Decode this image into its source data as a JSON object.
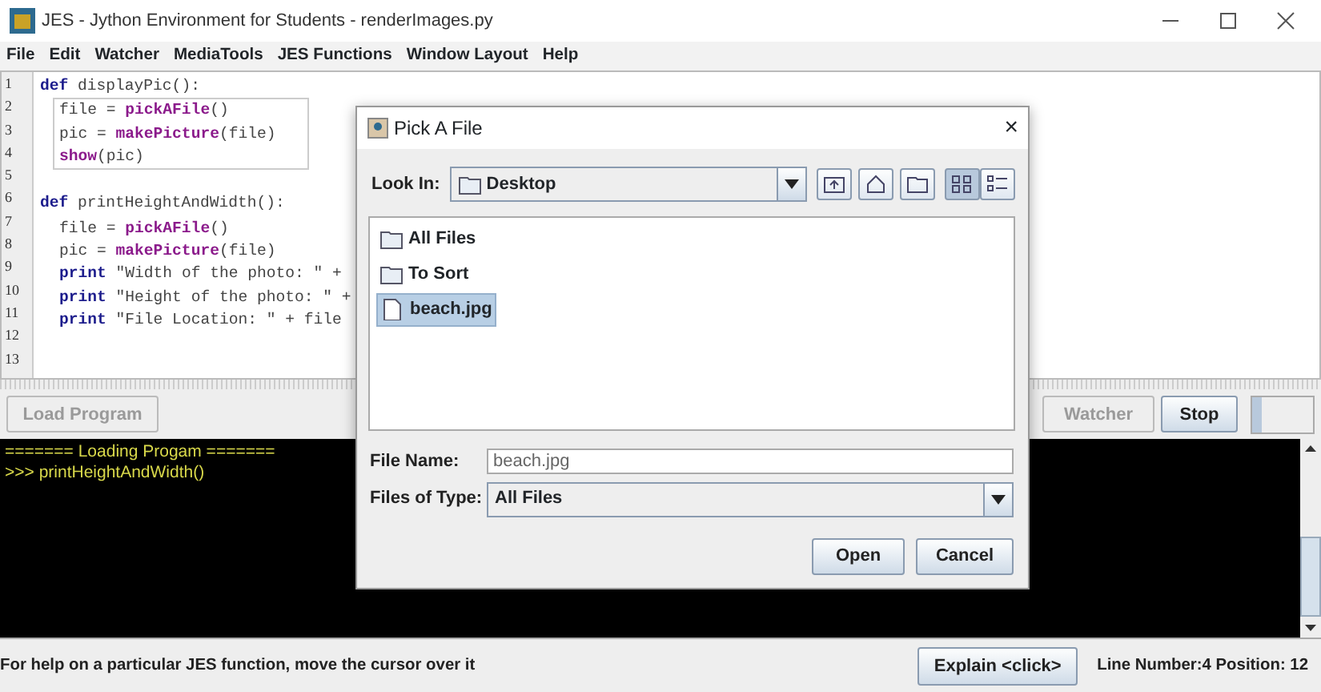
{
  "window": {
    "title": "JES - Jython Environment for Students - renderImages.py"
  },
  "menu": [
    "File",
    "Edit",
    "Watcher",
    "MediaTools",
    "JES Functions",
    "Window Layout",
    "Help"
  ],
  "editor": {
    "lines": [
      {
        "number": "1",
        "tokens": [
          {
            "kind": "keyword",
            "text": "def"
          },
          {
            "kind": "plain",
            "text": " displayPic():"
          }
        ],
        "body_boxed": true,
        "children": [
          {
            "number": "2",
            "tokens": [
              {
                "kind": "plain",
                "text": "file = "
              },
              {
                "kind": "builtin",
                "text": "pickAFile"
              },
              {
                "kind": "plain",
                "text": "()"
              }
            ]
          },
          {
            "number": "3",
            "tokens": [
              {
                "kind": "plain",
                "text": "pic = "
              },
              {
                "kind": "builtin",
                "text": "makePicture"
              },
              {
                "kind": "plain",
                "text": "(file)"
              }
            ]
          },
          {
            "number": "4",
            "tokens": [
              {
                "kind": "builtin",
                "text": "show"
              },
              {
                "kind": "plain",
                "text": "(pic)"
              }
            ]
          }
        ]
      },
      {
        "number": "5"
      },
      {
        "number": "6",
        "tokens": [
          {
            "kind": "keyword",
            "text": "def"
          },
          {
            "kind": "plain",
            "text": " printHeightAndWidth():"
          }
        ],
        "body_boxed": false,
        "children": [
          {
            "number": "7",
            "tokens": [
              {
                "kind": "plain",
                "text": "file = "
              },
              {
                "kind": "builtin",
                "text": "pickAFile"
              },
              {
                "kind": "plain",
                "text": "()"
              }
            ]
          },
          {
            "number": "8",
            "tokens": [
              {
                "kind": "plain",
                "text": "pic = "
              },
              {
                "kind": "builtin",
                "text": "makePicture"
              },
              {
                "kind": "plain",
                "text": "(file)"
              }
            ]
          },
          {
            "number": "9",
            "tokens": [
              {
                "kind": "keyword",
                "text": "print"
              },
              {
                "kind": "plain",
                "text": " \"Width of the photo: \" +"
              }
            ]
          },
          {
            "number": "10",
            "tokens": [
              {
                "kind": "keyword",
                "text": "print"
              },
              {
                "kind": "plain",
                "text": " \"Height of the photo: \" +"
              }
            ]
          },
          {
            "number": "11",
            "tokens": [
              {
                "kind": "keyword",
                "text": "print"
              },
              {
                "kind": "plain",
                "text": " \"File Location: \" + file"
              }
            ]
          }
        ]
      },
      {
        "number": "12"
      },
      {
        "number": "13"
      }
    ]
  },
  "toolbar": {
    "left": [
      {
        "label": "Load Program",
        "disabled": true
      }
    ],
    "right": [
      {
        "label": "Watcher",
        "disabled": true
      },
      {
        "label": "Stop",
        "disabled": false
      }
    ],
    "slider": {
      "level": 0.15
    }
  },
  "console": {
    "lines": [
      "======= Loading Progam =======",
      ">>> printHeightAndWidth()"
    ]
  },
  "status_bar": {
    "help": "For help on a particular JES function, move the cursor over it",
    "explain_button": "Explain <click>",
    "position": "Line Number:4 Position: 12"
  },
  "dialog": {
    "title": "Pick A File",
    "close": "×",
    "look_in": {
      "label": "Look In:",
      "value": "Desktop"
    },
    "nav_buttons": [
      {
        "kind": "up",
        "selected": false
      },
      {
        "kind": "home",
        "selected": false
      },
      {
        "kind": "newfolder",
        "selected": false
      },
      {
        "kind": "list",
        "selected": true
      },
      {
        "kind": "details",
        "selected": false
      }
    ],
    "files": [
      {
        "kind": "folder",
        "name": "All Files",
        "selected": false
      },
      {
        "kind": "folder",
        "name": "To Sort",
        "selected": false
      },
      {
        "kind": "file",
        "name": "beach.jpg",
        "selected": true
      }
    ],
    "file_name": {
      "label": "File Name:",
      "value": "beach.jpg"
    },
    "file_type": {
      "label": "Files of Type:",
      "value": "All Files"
    },
    "buttons": [
      "Open",
      "Cancel"
    ]
  }
}
